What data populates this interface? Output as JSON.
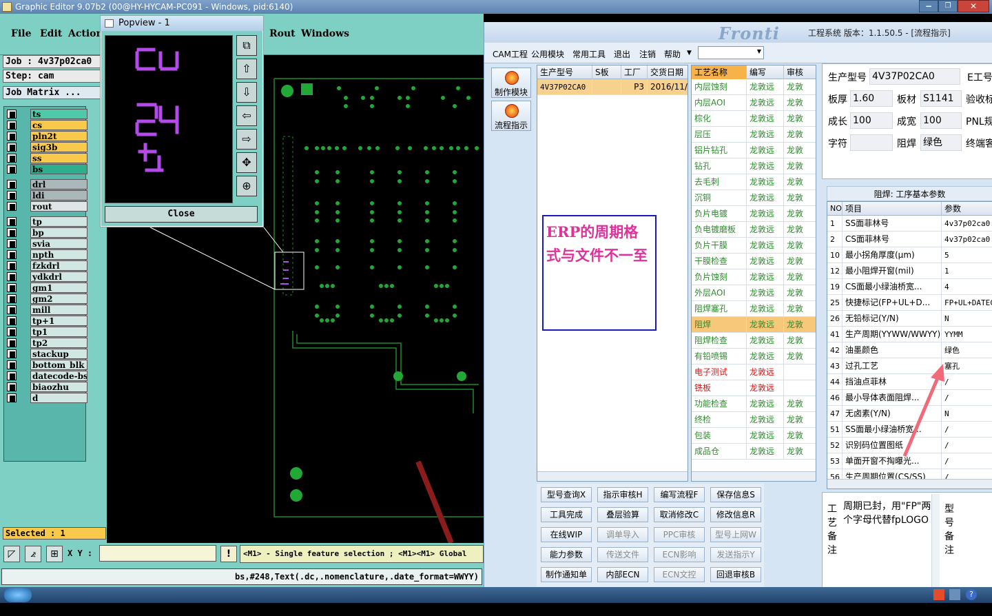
{
  "editor": {
    "title": "Graphic Editor 9.07b2 (00@HY-HYCAM-PC091 - Windows, pid:6140)",
    "menu": [
      "File",
      "Edit",
      "Actions",
      "Rout",
      "Windows"
    ],
    "job_label": "Job : 4v37p02ca0",
    "step_label": "Step: cam",
    "job_matrix_button": "Job Matrix ...",
    "layers": [
      {
        "name": "ts",
        "color": "#4fc9a7"
      },
      {
        "name": "cs",
        "color": "#f9c94c"
      },
      {
        "name": "pln2t",
        "color": "#f9c94c"
      },
      {
        "name": "sig3b",
        "color": "#f9c94c"
      },
      {
        "name": "ss",
        "color": "#f9c94c"
      },
      {
        "name": "bs",
        "color": "#2fae8e"
      },
      {
        "name": "drl",
        "color": "#aab8bc"
      },
      {
        "name": "ldi",
        "color": "#aab8bc"
      },
      {
        "name": "rout",
        "color": "#dfe6e8"
      },
      {
        "name": "tp",
        "color": "#d2e6e4"
      },
      {
        "name": "bp",
        "color": "#d2e6e4"
      },
      {
        "name": "svia",
        "color": "#d2e6e4"
      },
      {
        "name": "npth",
        "color": "#d2e6e4"
      },
      {
        "name": "fzkdrl",
        "color": "#d2e6e4"
      },
      {
        "name": "ydkdrl",
        "color": "#d2e6e4"
      },
      {
        "name": "gm1",
        "color": "#d2e6e4"
      },
      {
        "name": "gm2",
        "color": "#d2e6e4"
      },
      {
        "name": "mill",
        "color": "#d2e6e4"
      },
      {
        "name": "tp+1",
        "color": "#d2e6e4"
      },
      {
        "name": "tp1",
        "color": "#d2e6e4"
      },
      {
        "name": "tp2",
        "color": "#d2e6e4"
      },
      {
        "name": "stackup",
        "color": "#d2e6e4"
      },
      {
        "name": "bottom_blk_v",
        "color": "#d2e6e4"
      },
      {
        "name": "datecode-bs",
        "color": "#d2e6e4"
      },
      {
        "name": "biaozhu",
        "color": "#d2e6e4"
      },
      {
        "name": "d",
        "color": "#d2e6e4"
      }
    ],
    "selected_count": "Selected : 1",
    "xy_label": "X Y :",
    "xy_value": "",
    "hint": "<M1> - Single feature selection ; <M1><M1> Global",
    "command_line": "bs,#248,Text(.dc,.nomenclature,.date_format=WWYY)",
    "popview": {
      "title": "Popview - 1",
      "close_label": "Close"
    }
  },
  "erp": {
    "title": "工程系统  版本：1.1.50.5 - [流程指示]",
    "logo_text": "Fronti",
    "menu": [
      "CAM工程",
      "公用模块",
      "常用工具",
      "退出",
      "注销",
      "帮助"
    ],
    "side_buttons": [
      {
        "label": "制作模块",
        "icon": "fire-icon"
      },
      {
        "label": "流程指示",
        "icon": "flow-icon"
      }
    ],
    "order_grid": {
      "columns": [
        "生产型号",
        "S板",
        "工厂",
        "交货日期"
      ],
      "rows": [
        [
          "4V37P02CA0",
          "",
          "P3",
          "2016/11/"
        ]
      ]
    },
    "note": "ERP的周期格式与文件不一至",
    "process_grid": {
      "columns": [
        "工艺名称",
        "编写",
        "审核"
      ],
      "rows": [
        {
          "name": "内层蚀刻",
          "writer": "龙敦远",
          "checker": "龙敦",
          "color": "#2e8b2e"
        },
        {
          "name": "内层AOI",
          "writer": "龙敦远",
          "checker": "龙敦",
          "color": "#2e8b2e"
        },
        {
          "name": "棕化",
          "writer": "龙敦远",
          "checker": "龙敦",
          "color": "#2e8b2e"
        },
        {
          "name": "层压",
          "writer": "龙敦远",
          "checker": "龙敦",
          "color": "#2e8b2e"
        },
        {
          "name": "铝片钻孔",
          "writer": "龙敦远",
          "checker": "龙敦",
          "color": "#2e8b2e"
        },
        {
          "name": "钻孔",
          "writer": "龙敦远",
          "checker": "龙敦",
          "color": "#2e8b2e"
        },
        {
          "name": "去毛刺",
          "writer": "龙敦远",
          "checker": "龙敦",
          "color": "#2e8b2e"
        },
        {
          "name": "沉铜",
          "writer": "龙敦远",
          "checker": "龙敦",
          "color": "#2e8b2e"
        },
        {
          "name": "负片电镀",
          "writer": "龙敦远",
          "checker": "龙敦",
          "color": "#2e8b2e"
        },
        {
          "name": "负电镀磨板",
          "writer": "龙敦远",
          "checker": "龙敦",
          "color": "#2e8b2e"
        },
        {
          "name": "负片干膜",
          "writer": "龙敦远",
          "checker": "龙敦",
          "color": "#2e8b2e"
        },
        {
          "name": "干膜检查",
          "writer": "龙敦远",
          "checker": "龙敦",
          "color": "#2e8b2e"
        },
        {
          "name": "负片蚀刻",
          "writer": "龙敦远",
          "checker": "龙敦",
          "color": "#2e8b2e"
        },
        {
          "name": "外层AOI",
          "writer": "龙敦远",
          "checker": "龙敦",
          "color": "#2e8b2e"
        },
        {
          "name": "阻焊塞孔",
          "writer": "龙敦远",
          "checker": "龙敦",
          "color": "#2e8b2e"
        },
        {
          "name": "阻焊",
          "writer": "龙敦远",
          "checker": "龙敦",
          "color": "#2e8b2e",
          "selected": true
        },
        {
          "name": "阻焊检查",
          "writer": "龙敦远",
          "checker": "龙敦",
          "color": "#2e8b2e"
        },
        {
          "name": "有铅喷锡",
          "writer": "龙敦远",
          "checker": "龙敦",
          "color": "#2e8b2e"
        },
        {
          "name": "电子测试",
          "writer": "龙敦远",
          "checker": "",
          "color": "#d01818"
        },
        {
          "name": "铣板",
          "writer": "龙敦远",
          "checker": "",
          "color": "#d01818"
        },
        {
          "name": "功能检查",
          "writer": "龙敦远",
          "checker": "龙敦",
          "color": "#2e8b2e"
        },
        {
          "name": "终检",
          "writer": "龙敦远",
          "checker": "龙敦",
          "color": "#2e8b2e"
        },
        {
          "name": "包装",
          "writer": "龙敦远",
          "checker": "龙敦",
          "color": "#2e8b2e"
        },
        {
          "name": "成品仓",
          "writer": "龙敦远",
          "checker": "龙敦",
          "color": "#2e8b2e"
        }
      ]
    },
    "actions": [
      {
        "label": "型号查询X",
        "dim": false
      },
      {
        "label": "指示审核H",
        "dim": false
      },
      {
        "label": "编写流程F",
        "dim": false
      },
      {
        "label": "保存信息S",
        "dim": false
      },
      {
        "label": "工具完成",
        "dim": false
      },
      {
        "label": "叠层验算",
        "dim": false
      },
      {
        "label": "取消修改C",
        "dim": false
      },
      {
        "label": "修改信息R",
        "dim": false
      },
      {
        "label": "在线WIP",
        "dim": false
      },
      {
        "label": "调单导入",
        "dim": true
      },
      {
        "label": "PPC审核",
        "dim": true
      },
      {
        "label": "型号上网W",
        "dim": true
      },
      {
        "label": "能力参数",
        "dim": false
      },
      {
        "label": "传送文件",
        "dim": true
      },
      {
        "label": "ECN影响",
        "dim": true
      },
      {
        "label": "发送指示Y",
        "dim": true
      },
      {
        "label": "制作通知单",
        "dim": false
      },
      {
        "label": "内部ECN",
        "dim": false
      },
      {
        "label": "ECN文控",
        "dim": true
      },
      {
        "label": "回退审核B",
        "dim": false
      }
    ],
    "info": {
      "model_label": "生产型号",
      "model_value": "4V37P02CA0",
      "e_label": "E工号",
      "thickness_label": "板厚",
      "thickness_value": "1.60",
      "material_label": "板材",
      "material_value": "S1141",
      "accept_label": "验收标",
      "length_label": "成长",
      "length_value": "100",
      "width_label": "成宽",
      "width_value": "100",
      "pnl_label": "PNL规",
      "char_label": "字符",
      "char_value": "",
      "mask_label": "阻焊",
      "mask_value": "绿色",
      "end_label": "终端客"
    },
    "param_title": "阻焊: 工序基本参数",
    "param_grid": {
      "columns": [
        "NO",
        "项目",
        "参数"
      ],
      "rows": [
        [
          "1",
          "SS面菲林号",
          "4v37p02ca0."
        ],
        [
          "2",
          "CS面菲林号",
          "4v37p02ca0."
        ],
        [
          "10",
          "最小拐角厚度(μm)",
          "5"
        ],
        [
          "12",
          "最小阻焊开窗(mil)",
          "1"
        ],
        [
          "19",
          "CS面最小绿油桥宽...",
          "4"
        ],
        [
          "25",
          "快捷标记(FP+UL+D...",
          "FP+UL+DATEC"
        ],
        [
          "26",
          "无铅标记(Y/N)",
          "N"
        ],
        [
          "41",
          "生产周期(YYWW/WWYY)",
          "YYMM"
        ],
        [
          "42",
          "油墨颜色",
          "绿色"
        ],
        [
          "43",
          "过孔工艺",
          "塞孔"
        ],
        [
          "44",
          "挡油点菲林",
          "/"
        ],
        [
          "46",
          "最小导体表面阻焊...",
          "/"
        ],
        [
          "47",
          "无卤素(Y/N)",
          "N"
        ],
        [
          "51",
          "SS面最小绿油桥宽...",
          "/"
        ],
        [
          "52",
          "识别码位置图纸",
          "/"
        ],
        [
          "53",
          "单面开窗不掏曝光...",
          "/"
        ],
        [
          "56",
          "生产周期位置(CS/SS)",
          "/"
        ]
      ]
    },
    "remark_text": "周期已封，用\"FP\"两个字母代替fpLOGO",
    "remark_label_left": "工艺备注",
    "remark_label_right": "型号备注"
  }
}
